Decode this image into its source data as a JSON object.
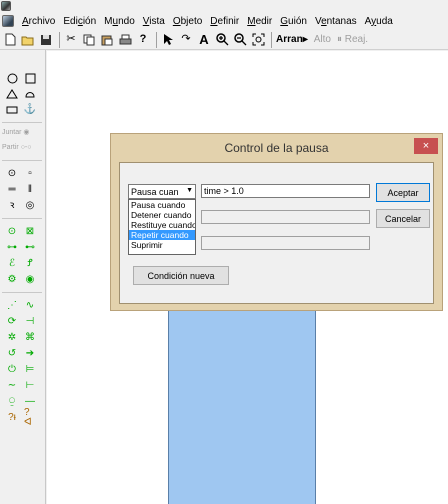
{
  "menu": {
    "items": [
      {
        "pre": "",
        "u": "A",
        "post": "rchivo"
      },
      {
        "pre": "Edi",
        "u": "c",
        "post": "ión"
      },
      {
        "pre": "M",
        "u": "u",
        "post": "ndo"
      },
      {
        "pre": "",
        "u": "V",
        "post": "ista"
      },
      {
        "pre": "",
        "u": "O",
        "post": "bjeto"
      },
      {
        "pre": "",
        "u": "D",
        "post": "efinir"
      },
      {
        "pre": "",
        "u": "M",
        "post": "edir"
      },
      {
        "pre": "",
        "u": "G",
        "post": "uión"
      },
      {
        "pre": "V",
        "u": "e",
        "post": "ntanas"
      },
      {
        "pre": "A",
        "u": "y",
        "post": "uda"
      }
    ]
  },
  "toolbar": {
    "run_label": "Arran",
    "height_label": "Alto",
    "reset_label": "Reaj."
  },
  "palette": {
    "join_label": "Juntar",
    "split_label": "Partir"
  },
  "dialog": {
    "title": "Control de la pausa",
    "close": "×",
    "combo_value": "Pausa cuan",
    "options": [
      "Pausa cuando",
      "Detener cuando",
      "Restituye cuando",
      "Repetir cuando",
      "Suprimir"
    ],
    "selected_option_index": 3,
    "condition_1": "time > 1.0",
    "condition_2": "",
    "condition_3": "",
    "accept_label": "Aceptar",
    "cancel_label": "Cancelar",
    "new_condition_label": "Condición nueva"
  },
  "colors": {
    "dialog_frame": "#e3d2ad",
    "close_button": "#c75050",
    "selection": "#3399ff",
    "body_fill": "#9fc7f1"
  }
}
